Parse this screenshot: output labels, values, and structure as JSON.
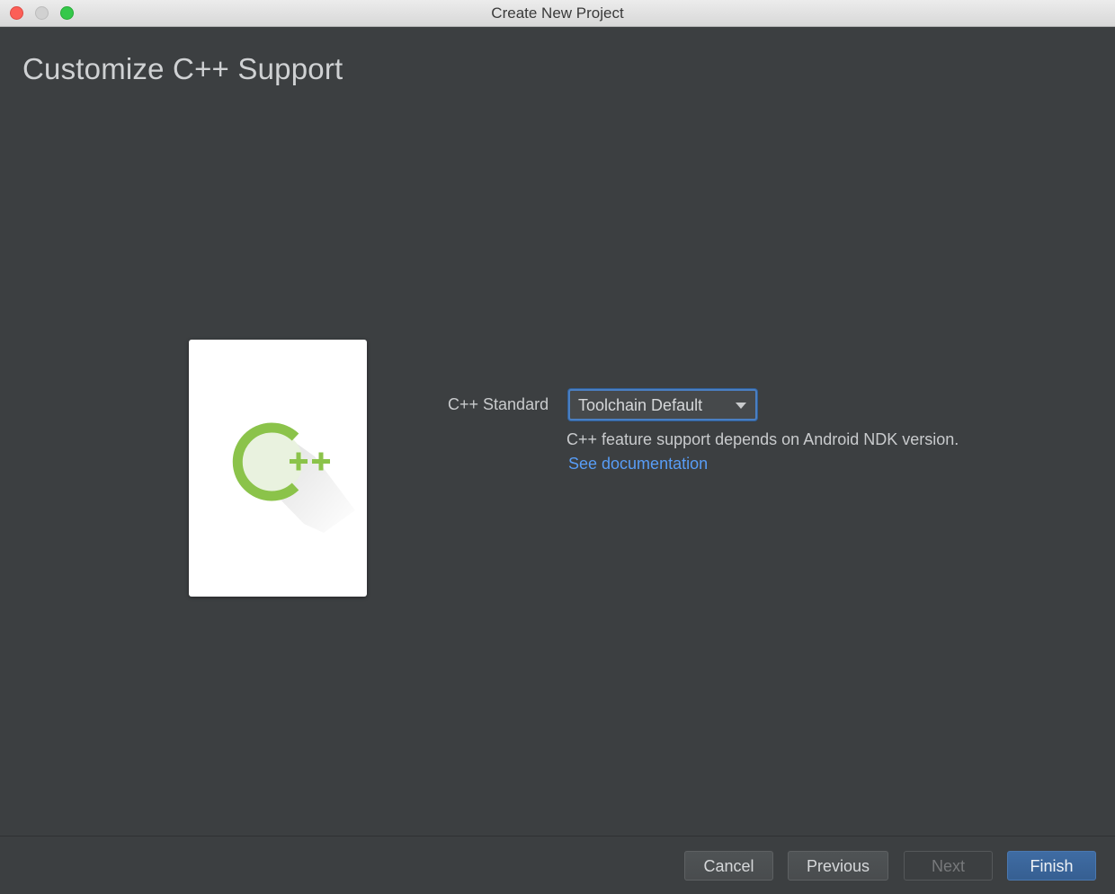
{
  "window": {
    "title": "Create New Project"
  },
  "page": {
    "title": "Customize C++ Support"
  },
  "template_card": {
    "icon": "cpp-logo-icon",
    "logo_letter": "C",
    "logo_suffix": "++",
    "logo_color": "#8bc34a"
  },
  "form": {
    "cpp_standard_label": "C++ Standard",
    "cpp_standard_value": "Toolchain Default",
    "hint_text": "C++ feature support depends on Android NDK version.",
    "doc_link": "See documentation"
  },
  "footer": {
    "cancel_label": "Cancel",
    "previous_label": "Previous",
    "next_label": "Next",
    "finish_label": "Finish",
    "next_enabled": false
  },
  "colors": {
    "background": "#3c3f41",
    "accent_blue": "#4a7fc2",
    "link": "#589df6",
    "primary_button": "#365f92"
  }
}
